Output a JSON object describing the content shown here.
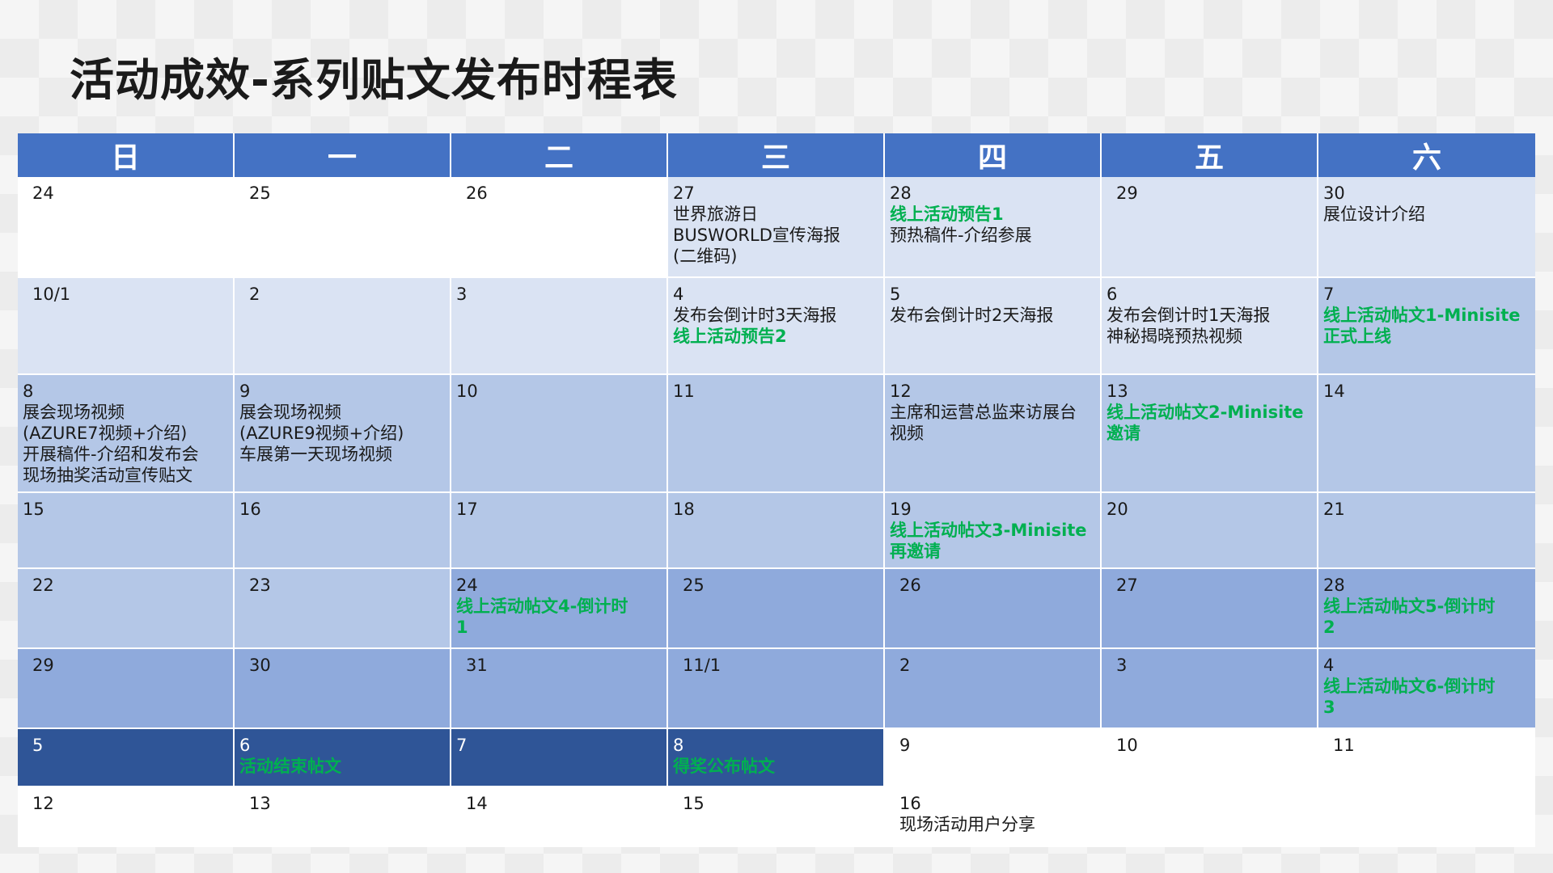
{
  "title": "活动成效-系列贴文发布时程表",
  "colors": {
    "header": "#4472c4",
    "highlight": "#00b050",
    "row_shades": [
      "#ffffff",
      "#dae3f3",
      "#b4c7e7",
      "#8faadc",
      "#2f5597"
    ]
  },
  "weekdays": [
    "日",
    "一",
    "二",
    "三",
    "四",
    "五",
    "六"
  ],
  "weeks": [
    [
      {
        "day": "24",
        "lines": []
      },
      {
        "day": "25",
        "lines": []
      },
      {
        "day": "26",
        "lines": []
      },
      {
        "day": "27",
        "lines": [
          {
            "text": "世界旅游日"
          },
          {
            "text": "BUSWORLD宣传海报"
          },
          {
            "text": "(二维码)"
          }
        ]
      },
      {
        "day": "28",
        "lines": [
          {
            "text": "线上活动预告1",
            "hl": true
          },
          {
            "text": "预热稿件-介绍参展"
          }
        ]
      },
      {
        "day": "29",
        "lines": []
      },
      {
        "day": "30",
        "lines": [
          {
            "text": "展位设计介绍"
          }
        ]
      }
    ],
    [
      {
        "day": "10/1",
        "lines": []
      },
      {
        "day": "2",
        "lines": []
      },
      {
        "day": "3",
        "lines": []
      },
      {
        "day": "4",
        "lines": [
          {
            "text": "发布会倒计时3天海报"
          },
          {
            "text": "线上活动预告2",
            "hl": true
          }
        ]
      },
      {
        "day": "5",
        "lines": [
          {
            "text": "发布会倒计时2天海报"
          }
        ]
      },
      {
        "day": "6",
        "lines": [
          {
            "text": "发布会倒计时1天海报"
          },
          {
            "text": "神秘揭晓预热视频"
          }
        ]
      },
      {
        "day": "7",
        "lines": [
          {
            "text": "线上活动帖文1-Minisite",
            "hl": true
          },
          {
            "text": "正式上线",
            "hl": true
          }
        ]
      }
    ],
    [
      {
        "day": "8",
        "lines": [
          {
            "text": "展会现场视频"
          },
          {
            "text": "(AZURE7视频+介绍)"
          },
          {
            "text": "开展稿件-介绍和发布会"
          },
          {
            "text": "现场抽奖活动宣传贴文"
          }
        ]
      },
      {
        "day": "9",
        "lines": [
          {
            "text": "展会现场视频"
          },
          {
            "text": "(AZURE9视频+介绍)"
          },
          {
            "text": "车展第一天现场视频"
          }
        ]
      },
      {
        "day": "10",
        "lines": []
      },
      {
        "day": "11",
        "lines": []
      },
      {
        "day": "12",
        "lines": [
          {
            "text": "主席和运营总监来访展台"
          },
          {
            "text": "视频"
          }
        ]
      },
      {
        "day": "13",
        "lines": [
          {
            "text": "线上活动帖文2-Minisite",
            "hl": true
          },
          {
            "text": "邀请",
            "hl": true
          }
        ]
      },
      {
        "day": "14",
        "lines": []
      }
    ],
    [
      {
        "day": "15",
        "lines": []
      },
      {
        "day": "16",
        "lines": []
      },
      {
        "day": "17",
        "lines": []
      },
      {
        "day": "18",
        "lines": []
      },
      {
        "day": "19",
        "lines": [
          {
            "text": "线上活动帖文3-Minisite",
            "hl": true
          },
          {
            "text": "再邀请",
            "hl": true
          }
        ]
      },
      {
        "day": "20",
        "lines": []
      },
      {
        "day": "21",
        "lines": []
      }
    ],
    [
      {
        "day": "22",
        "lines": []
      },
      {
        "day": "23",
        "lines": []
      },
      {
        "day": "24",
        "lines": [
          {
            "text": "线上活动帖文4-倒计时",
            "hl": true
          },
          {
            "text": "1",
            "hl": true
          }
        ]
      },
      {
        "day": "25",
        "lines": []
      },
      {
        "day": "26",
        "lines": []
      },
      {
        "day": "27",
        "lines": []
      },
      {
        "day": "28",
        "lines": [
          {
            "text": "线上活动帖文5-倒计时",
            "hl": true
          },
          {
            "text": "2",
            "hl": true
          }
        ]
      }
    ],
    [
      {
        "day": "29",
        "lines": []
      },
      {
        "day": "30",
        "lines": []
      },
      {
        "day": "31",
        "lines": []
      },
      {
        "day": "11/1",
        "lines": []
      },
      {
        "day": "2",
        "lines": []
      },
      {
        "day": "3",
        "lines": []
      },
      {
        "day": "4",
        "lines": [
          {
            "text": "线上活动帖文6-倒计时",
            "hl": true
          },
          {
            "text": "3",
            "hl": true
          }
        ]
      }
    ],
    [
      {
        "day": "5",
        "lines": []
      },
      {
        "day": "6",
        "lines": [
          {
            "text": "活动结束帖文",
            "hl": true
          }
        ]
      },
      {
        "day": "7",
        "lines": []
      },
      {
        "day": "8",
        "lines": [
          {
            "text": "得奖公布帖文",
            "hl": true
          }
        ]
      },
      {
        "day": "9",
        "lines": []
      },
      {
        "day": "10",
        "lines": []
      },
      {
        "day": "11",
        "lines": []
      }
    ],
    [
      {
        "day": "12",
        "lines": []
      },
      {
        "day": "13",
        "lines": []
      },
      {
        "day": "14",
        "lines": []
      },
      {
        "day": "15",
        "lines": []
      },
      {
        "day": "16",
        "lines": [
          {
            "text": "现场活动用户分享"
          }
        ]
      },
      {
        "day": "",
        "lines": []
      },
      {
        "day": "",
        "lines": []
      }
    ]
  ]
}
